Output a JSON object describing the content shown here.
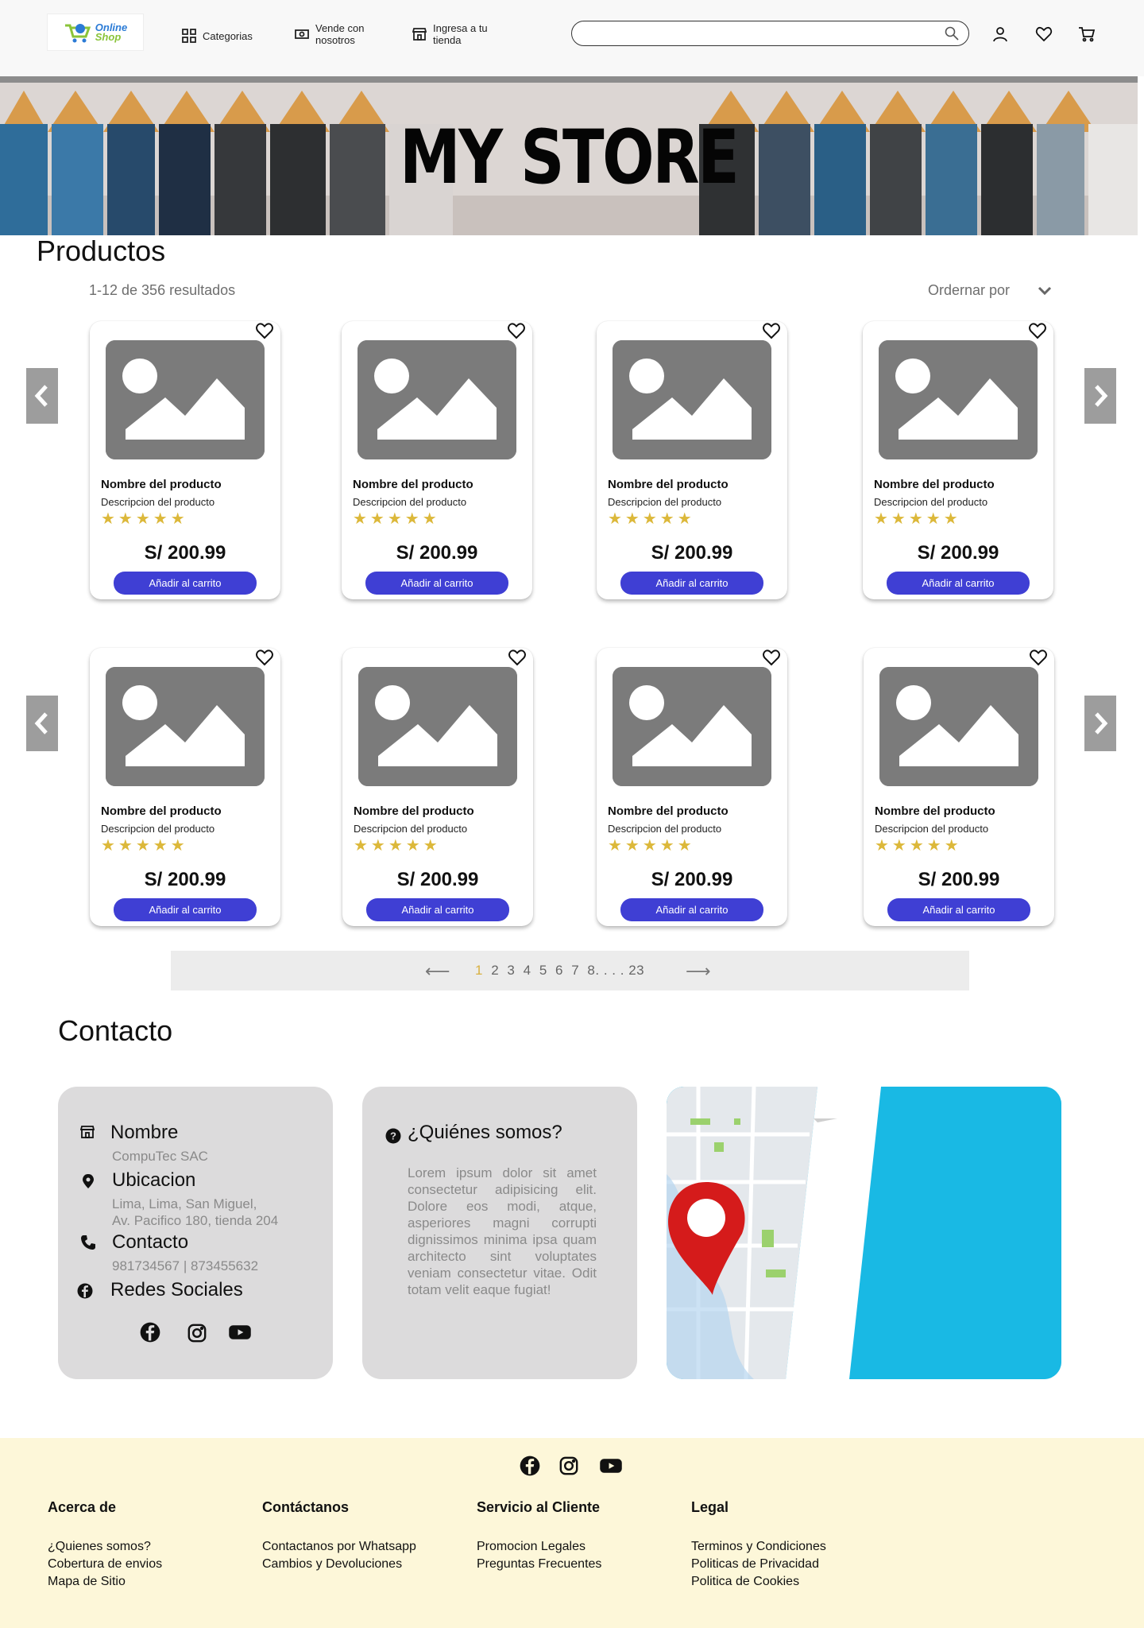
{
  "header": {
    "logo": {
      "line1": "Online",
      "line2": "Shop"
    },
    "nav": [
      {
        "label": "Categorias",
        "icon": "grid-icon"
      },
      {
        "label": "Vende con nosotros",
        "icon": "money-icon"
      },
      {
        "label": "Ingresa a tu tienda",
        "icon": "store-icon"
      }
    ],
    "search": {
      "value": "",
      "placeholder": ""
    }
  },
  "hero": {
    "title": "MY STORE"
  },
  "products": {
    "title": "Productos",
    "results": "1-12 de 356 resultados",
    "sort_label": "Ordernar por",
    "items": [
      {
        "name": "Nombre del producto",
        "description": "Descripcion del producto",
        "rating": 5,
        "stars": "★★★★★",
        "price": "S/ 200.99",
        "button": "Añadir al carrito"
      },
      {
        "name": "Nombre del producto",
        "description": "Descripcion del producto",
        "rating": 5,
        "stars": "★★★★★",
        "price": "S/ 200.99",
        "button": "Añadir al carrito"
      },
      {
        "name": "Nombre del producto",
        "description": "Descripcion del producto",
        "rating": 5,
        "stars": "★★★★★",
        "price": "S/ 200.99",
        "button": "Añadir al carrito"
      },
      {
        "name": "Nombre del producto",
        "description": "Descripcion del producto",
        "rating": 5,
        "stars": "★★★★★",
        "price": "S/ 200.99",
        "button": "Añadir al carrito"
      },
      {
        "name": "Nombre del producto",
        "description": "Descripcion del producto",
        "rating": 5,
        "stars": "★★★★★",
        "price": "S/ 200.99",
        "button": "Añadir al carrito"
      },
      {
        "name": "Nombre del producto",
        "description": "Descripcion del producto",
        "rating": 5,
        "stars": "★★★★★",
        "price": "S/ 200.99",
        "button": "Añadir al carrito"
      },
      {
        "name": "Nombre del producto",
        "description": "Descripcion del producto",
        "rating": 5,
        "stars": "★★★★★",
        "price": "S/ 200.99",
        "button": "Añadir al carrito"
      },
      {
        "name": "Nombre del producto",
        "description": "Descripcion del producto",
        "rating": 5,
        "stars": "★★★★★",
        "price": "S/ 200.99",
        "button": "Añadir al carrito"
      }
    ]
  },
  "pagination": {
    "prev": "⟵",
    "next": "⟶",
    "pages": [
      "1",
      "2",
      "3",
      "4",
      "5",
      "6",
      "7",
      "8"
    ],
    "ellipsis": ". . . .",
    "last": "23",
    "current": "1"
  },
  "contact": {
    "title": "Contacto",
    "name_label": "Nombre",
    "name_value": "CompuTec SAC",
    "location_label": "Ubicacion",
    "location_line1": "Lima, Lima, San Miguel,",
    "location_line2": "Av. Pacifico 180, tienda 204",
    "phone_label": "Contacto",
    "phone_value": "981734567 | 873455632",
    "social_label": "Redes Sociales",
    "about_title": "¿Quiénes somos?",
    "about_text": "Lorem ipsum dolor sit amet consectetur adipisicing elit. Dolore eos modi, atque, asperiores magni corrupti dignissimos minima ipsa quam architecto sint voluptates veniam consectetur vitae. Odit totam velit eaque fugiat!"
  },
  "footer": {
    "columns": [
      {
        "title": "Acerca de",
        "links": [
          "¿Quienes somos?",
          "Cobertura de envios",
          "Mapa de Sitio"
        ]
      },
      {
        "title": "Contáctanos",
        "links": [
          "Contactanos por Whatsapp",
          "Cambios y Devoluciones"
        ]
      },
      {
        "title": "Servicio al Cliente",
        "links": [
          "Promocion Legales",
          "Preguntas Frecuentes"
        ]
      },
      {
        "title": "Legal",
        "links": [
          "Terminos y Condiciones",
          "Politicas de Privacidad",
          "Politica de Cookies"
        ]
      }
    ]
  },
  "colors": {
    "accent_button": "#3f3fd4",
    "star": "#dcb83a",
    "page_active": "#d8b040",
    "footer_bg": "#fdf7d9",
    "contact_box": "#dcdbdc"
  }
}
